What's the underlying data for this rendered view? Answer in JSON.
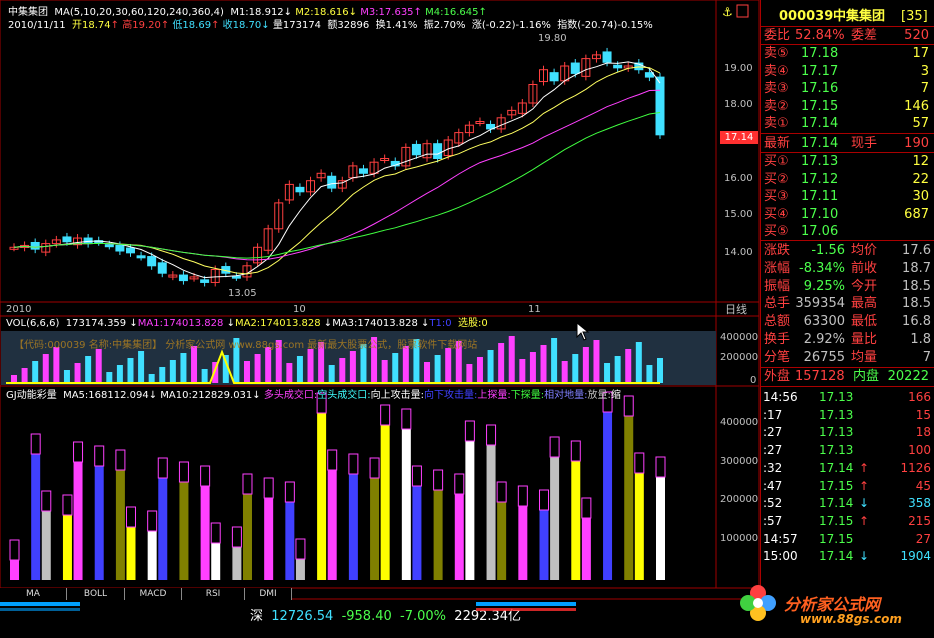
{
  "header": {
    "stock_name": "中集集团",
    "ma_params": "MA(5,10,20,30,60,120,240,360,4)",
    "m1": "M1:18.912",
    "m2": "M2:18.616",
    "m3": "M3:17.635",
    "m4": "M4:16.645",
    "date": "2010/11/11",
    "open": "开18.74",
    "high": "高19.20",
    "low": "低18.69",
    "close": "收18.70",
    "volume": "量173174",
    "amount": "额32896",
    "turnover": "换1.41%",
    "amplitude": "振2.70%",
    "change": "涨(-0.22)-1.16%",
    "index": "指数(-20.74)-0.15%"
  },
  "price_chart": {
    "y_ticks": [
      "19.00",
      "18.00",
      "17.00",
      "16.00",
      "15.00",
      "14.00"
    ],
    "x_labels": [
      "2010",
      "10",
      "11"
    ],
    "period_label": "日线",
    "current_price_tag": "17.14",
    "max_label": "19.80",
    "min_label": "13.05"
  },
  "vol_panel": {
    "title": "VOL(6,6,6)",
    "value": "173174.359",
    "ma1": "MA1:174013.828",
    "ma2": "MA2:174013.828",
    "ma3": "MA3:174013.828",
    "t1": "T1:0",
    "select": "选股:0",
    "watermark": "【代码:000039 名称:中集集团】 分析家公式网 www.88gs.com 最新最大股票公式，股票软件下载网站",
    "y_ticks": [
      "400000",
      "200000",
      "0"
    ]
  },
  "gj_panel": {
    "title": "GJ动能彩量",
    "ma5": "MA5:168112.094",
    "ma10": "MA10:212829.031",
    "legend": [
      {
        "label": "多头成交口",
        "color": "#ff40ff"
      },
      {
        "label": "空头成交口",
        "color": "#40ffff"
      },
      {
        "label": "向上攻击量",
        "color": "#ffffff"
      },
      {
        "label": "向下攻击量",
        "color": "#4040ff"
      },
      {
        "label": "上探量",
        "color": "#ff40ff"
      },
      {
        "label": "下探量",
        "color": "#40ff40"
      },
      {
        "label": "相对地量",
        "color": "#8080ff"
      },
      {
        "label": "放量",
        "color": "#c0c0c0"
      },
      {
        "label": "缩",
        "color": "#ffffff"
      }
    ],
    "y_ticks": [
      "400000",
      "300000",
      "200000",
      "100000"
    ]
  },
  "tabs": [
    "MA",
    "BOLL",
    "MACD",
    "RSI",
    "DMI"
  ],
  "quote": {
    "code": "000039",
    "name": "中集集团",
    "badge": "[35]",
    "weibi_label": "委比",
    "weibi_value": "52.84%",
    "weicha_label": "委差",
    "weicha_value": "520",
    "sells": [
      {
        "label": "卖⑤",
        "price": "17.18",
        "vol": "17"
      },
      {
        "label": "卖④",
        "price": "17.17",
        "vol": "3"
      },
      {
        "label": "卖③",
        "price": "17.16",
        "vol": "7"
      },
      {
        "label": "卖②",
        "price": "17.15",
        "vol": "146"
      },
      {
        "label": "卖①",
        "price": "17.14",
        "vol": "57"
      }
    ],
    "latest_label": "最新",
    "latest_price": "17.14",
    "xianshou_label": "现手",
    "xianshou_value": "190",
    "buys": [
      {
        "label": "买①",
        "price": "17.13",
        "vol": "12"
      },
      {
        "label": "买②",
        "price": "17.12",
        "vol": "22"
      },
      {
        "label": "买③",
        "price": "17.11",
        "vol": "30"
      },
      {
        "label": "买④",
        "price": "17.10",
        "vol": "687"
      },
      {
        "label": "买⑤",
        "price": "17.06",
        "vol": ""
      }
    ],
    "stats": [
      {
        "l1": "涨跌",
        "v1": "-1.56",
        "l2": "均价",
        "v2": "17.6"
      },
      {
        "l1": "涨幅",
        "v1": "-8.34%",
        "l2": "前收",
        "v2": "18.7"
      },
      {
        "l1": "振幅",
        "v1": "9.25%",
        "l2": "今开",
        "v2": "18.5"
      },
      {
        "l1": "总手",
        "v1": "359354",
        "l2": "最高",
        "v2": "18.5"
      },
      {
        "l1": "总额",
        "v1": "63300",
        "l2": "最低",
        "v2": "16.8"
      },
      {
        "l1": "换手",
        "v1": "2.92%",
        "l2": "量比",
        "v2": "1.8"
      },
      {
        "l1": "分笔",
        "v1": "26755",
        "l2": "均量",
        "v2": "7"
      }
    ],
    "waipan_label": "外盘",
    "waipan_value": "157128",
    "neipan_label": "内盘",
    "neipan_value": "20222"
  },
  "ticks": [
    {
      "time": "14:56",
      "price": "17.13",
      "arrow": "",
      "vol": "166"
    },
    {
      "time": ":17",
      "price": "17.13",
      "arrow": "",
      "vol": "15"
    },
    {
      "time": ":27",
      "price": "17.13",
      "arrow": "",
      "vol": "18"
    },
    {
      "time": ":27",
      "price": "17.13",
      "arrow": "",
      "vol": "100"
    },
    {
      "time": ":32",
      "price": "17.14",
      "arrow": "↑",
      "vol": "1126"
    },
    {
      "time": ":47",
      "price": "17.15",
      "arrow": "↑",
      "vol": "45"
    },
    {
      "time": ":52",
      "price": "17.14",
      "arrow": "↓",
      "vol": "358"
    },
    {
      "time": ":57",
      "price": "17.15",
      "arrow": "↑",
      "vol": "215"
    },
    {
      "time": "14:57",
      "price": "17.15",
      "arrow": "",
      "vol": "27"
    },
    {
      "time": "15:00",
      "price": "17.14",
      "arrow": "↓",
      "vol": "1904"
    }
  ],
  "status": {
    "market": "深",
    "index_value": "12726.54",
    "index_change": "-958.40",
    "index_pct": "-7.00%",
    "turnover": "2292.34亿",
    "logo_text": "分析家公式网",
    "logo_url": "www.88gs.com"
  }
}
